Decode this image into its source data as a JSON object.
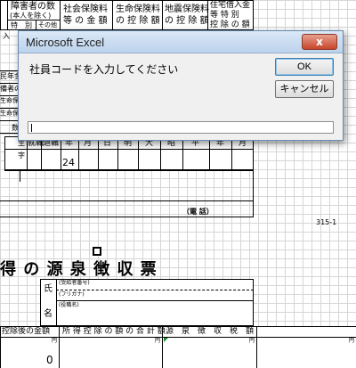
{
  "dialog": {
    "title": "Microsoft Excel",
    "close_label": "x",
    "prompt": "社員コードを入力してください",
    "ok_label": "OK",
    "cancel_label": "キャンセル",
    "input_value": ""
  },
  "sheet": {
    "hdr_disabled": "障害者の数",
    "hdr_disabled_sub": "(本人を除く)",
    "hdr_special": "特　別",
    "hdr_other": "その他",
    "hdr_social_a": "社会保険料",
    "hdr_social_b": "等 の 金 額",
    "hdr_life_a": "生命保険料",
    "hdr_life_b": "の 控 除 額",
    "hdr_quake_a": "地震保険料",
    "hdr_quake_b": "の 控 除 額",
    "hdr_housing_a": "住宅借入金",
    "hdr_housing_b": "等 特 別",
    "hdr_housing_c": "控 除 の 額",
    "left_row1": "民年金",
    "left_row2": "備者の",
    "left_row3": "生命保",
    "left_row4": "生命保",
    "left_cut1": "入",
    "left_cut2": "数",
    "left_birth": "生",
    "left_ji": "字",
    "col_shusho": "就職",
    "col_taishoku": "退職",
    "col_nen": "年",
    "col_tsuki": "月",
    "col_hi": "日",
    "col_meiji": "明",
    "col_taisho": "大",
    "col_showa": "昭",
    "col_heisei": "平",
    "col_nen2": "年",
    "col_tsuki2": "月",
    "value_24": "24",
    "phone_label": "（電 話）",
    "form_no": "315-1",
    "big_title": "得 の 源 泉 徴 収 票",
    "label_shi": "氏",
    "label_mei": "名",
    "addr_small": "(受給者番号)",
    "kana_small": "(フリガナ)",
    "position_small": "(役職名)",
    "bottom_h1": "控除後の金額",
    "bottom_h2": "所 得 控 除 の 額 の 合 計 額",
    "bottom_h3": "源　泉　徴　収　税　額",
    "yen1": "円",
    "yen2": "円",
    "yen3": "円",
    "yen4": "円",
    "zero_value": "0"
  }
}
